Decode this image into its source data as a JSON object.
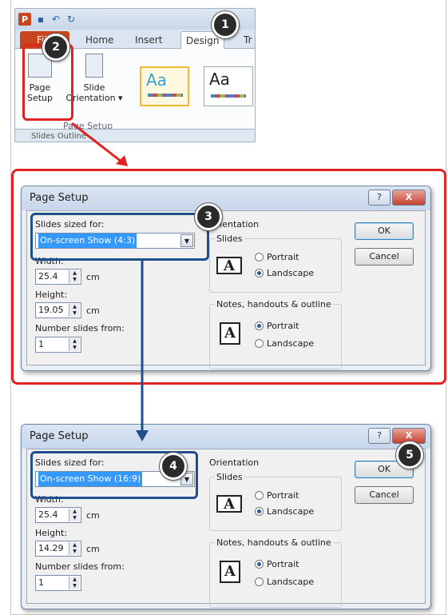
{
  "ribbon": {
    "tabs": {
      "file": "File",
      "home": "Home",
      "insert": "Insert",
      "design": "Design",
      "transitions": "Tr"
    },
    "page_setup": {
      "line1": "Page",
      "line2": "Setup"
    },
    "slide_orientation": {
      "line1": "Slide",
      "line2": "Orientation ▾"
    },
    "group_label": "Page Setup",
    "theme1": "Aa",
    "theme2": "Aa",
    "bottom_tabs": "Slides    Outline"
  },
  "callouts": [
    "1",
    "2",
    "3",
    "4",
    "5"
  ],
  "dialog1": {
    "title": "Page Setup",
    "help": "?",
    "close": "X",
    "slides_sized_for_label": "Slides sized for:",
    "slides_sized_for_value": "On-screen Show (4:3)",
    "width_label": "Width:",
    "width_value": "25.4",
    "width_unit": "cm",
    "height_label": "Height:",
    "height_value": "19.05",
    "height_unit": "cm",
    "number_from_label": "Number slides from:",
    "number_from_value": "1",
    "orientation_label": "Orientation",
    "slides_group": "Slides",
    "portrait": "Portrait",
    "landscape": "Landscape",
    "notes_group": "Notes, handouts & outline",
    "notes_portrait": "Portrait",
    "notes_landscape": "Landscape",
    "ok": "OK",
    "cancel": "Cancel"
  },
  "dialog2": {
    "title": "Page Setup",
    "help": "?",
    "close": "X",
    "slides_sized_for_label": "Slides sized for:",
    "slides_sized_for_value": "On-screen Show (16:9)",
    "width_label": "Width:",
    "width_value": "25.4",
    "width_unit": "cm",
    "height_label": "Height:",
    "height_value": "14.29",
    "height_unit": "cm",
    "number_from_label": "Number slides from:",
    "number_from_value": "1",
    "orientation_label": "Orientation",
    "slides_group": "Slides",
    "portrait": "Portrait",
    "landscape": "Landscape",
    "notes_group": "Notes, handouts & outline",
    "notes_portrait": "Portrait",
    "notes_landscape": "Landscape",
    "ok": "OK",
    "cancel": "Cancel"
  },
  "colors": {
    "highlight_red": "#e02424",
    "highlight_blue": "#1f4e8a",
    "office_file_tab": "#c7461d"
  }
}
